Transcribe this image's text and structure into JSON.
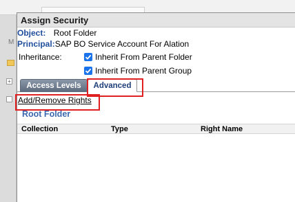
{
  "background": {
    "letter": "M",
    "expand_icon": "+"
  },
  "dialog": {
    "title": "Assign Security",
    "object_label": "Object:",
    "object_value": "Root Folder",
    "principal_label": "Principal:",
    "principal_value": "SAP BO Service Account For Alation",
    "inheritance_label": "Inheritance:",
    "checkboxes": [
      {
        "label": "Inherit From Parent Folder",
        "checked": true
      },
      {
        "label": "Inherit From Parent Group",
        "checked": true
      }
    ],
    "tabs": [
      {
        "label": "Access Levels",
        "active": false
      },
      {
        "label": "Advanced",
        "active": true
      }
    ],
    "add_remove_link": "Add/Remove Rights",
    "section_title": "Root Folder",
    "columns": [
      "Collection",
      "Type",
      "Right Name"
    ],
    "rows": []
  },
  "colors": {
    "accent_blue": "#1f4e9c",
    "checkbox_blue": "#1a73e8",
    "highlight_red": "#e02020",
    "tab_inactive": "#5c6a7d"
  },
  "icons": {
    "checkbox": "check-icon",
    "folder": "folder-icon"
  }
}
